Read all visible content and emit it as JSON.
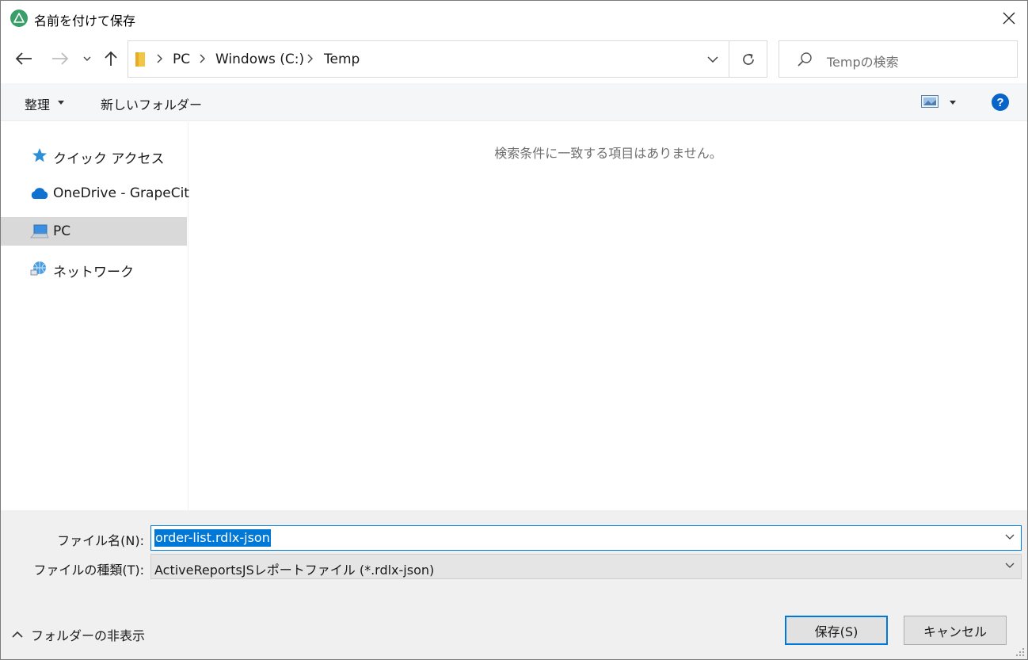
{
  "window": {
    "title": "名前を付けて保存"
  },
  "address": {
    "breadcrumbs": [
      "PC",
      "Windows (C:)",
      "Temp"
    ]
  },
  "search": {
    "placeholder": "Tempの検索"
  },
  "commandbar": {
    "organize_label": "整理",
    "new_folder_label": "新しいフォルダー",
    "help_label": "?"
  },
  "sidebar": {
    "items": [
      {
        "label": "クイック アクセス",
        "icon": "star-icon"
      },
      {
        "label": "OneDrive - GrapeCity",
        "icon": "cloud-icon"
      },
      {
        "label": "PC",
        "icon": "computer-icon",
        "selected": true
      },
      {
        "label": "ネットワーク",
        "icon": "network-icon"
      }
    ]
  },
  "content": {
    "empty_message": "検索条件に一致する項目はありません。"
  },
  "form": {
    "filename_label": "ファイル名(N):",
    "filename_value": "order-list.rdlx-json",
    "filetype_label": "ファイルの種類(T):",
    "filetype_value": "ActiveReportsJSレポートファイル (*.rdlx-json)",
    "hide_folders_label": "フォルダーの非表示",
    "save_label": "保存(S)",
    "cancel_label": "キャンセル"
  },
  "colors": {
    "accent": "#0078d7",
    "selection_bg": "#d9d9d9",
    "panel_bg": "#f0f0f0"
  }
}
